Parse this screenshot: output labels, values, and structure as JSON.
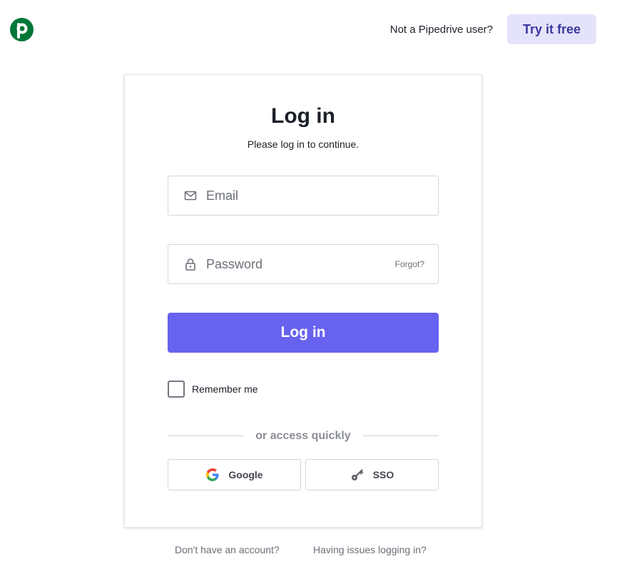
{
  "header": {
    "not_user_text": "Not a Pipedrive user?",
    "try_label": "Try it free",
    "logo_letter": "p",
    "brand_color": "#017737"
  },
  "card": {
    "title": "Log in",
    "subtitle": "Please log in to continue.",
    "email": {
      "placeholder": "Email",
      "value": ""
    },
    "password": {
      "placeholder": "Password",
      "value": "",
      "forgot_label": "Forgot?"
    },
    "login_label": "Log in",
    "login_color": "#6762ef",
    "remember_label": "Remember me",
    "remember_checked": false,
    "divider_label": "or access quickly",
    "google_label": "Google",
    "sso_label": "SSO"
  },
  "footer": {
    "signup_label": "Don't have an account?",
    "issues_label": "Having issues logging in?"
  },
  "icons": [
    "pipedrive-logo-icon",
    "mail-icon",
    "lock-icon",
    "google-icon",
    "key-icon"
  ]
}
